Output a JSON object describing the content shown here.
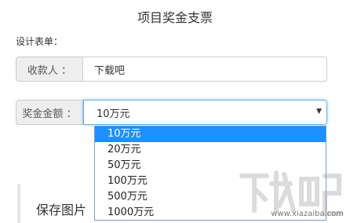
{
  "page": {
    "title": "项目奖金支票",
    "section_label": "设计表单："
  },
  "payee": {
    "label": "收款人 ：",
    "value": "下载吧"
  },
  "amount": {
    "label": "奖金金额 ：",
    "selected": "10万元",
    "options": [
      "10万元",
      "20万元",
      "50万元",
      "100万元",
      "500万元",
      "1000万元"
    ]
  },
  "save": {
    "label": "保存图片"
  },
  "watermark": {
    "text": "www.xiazaiba.com"
  }
}
